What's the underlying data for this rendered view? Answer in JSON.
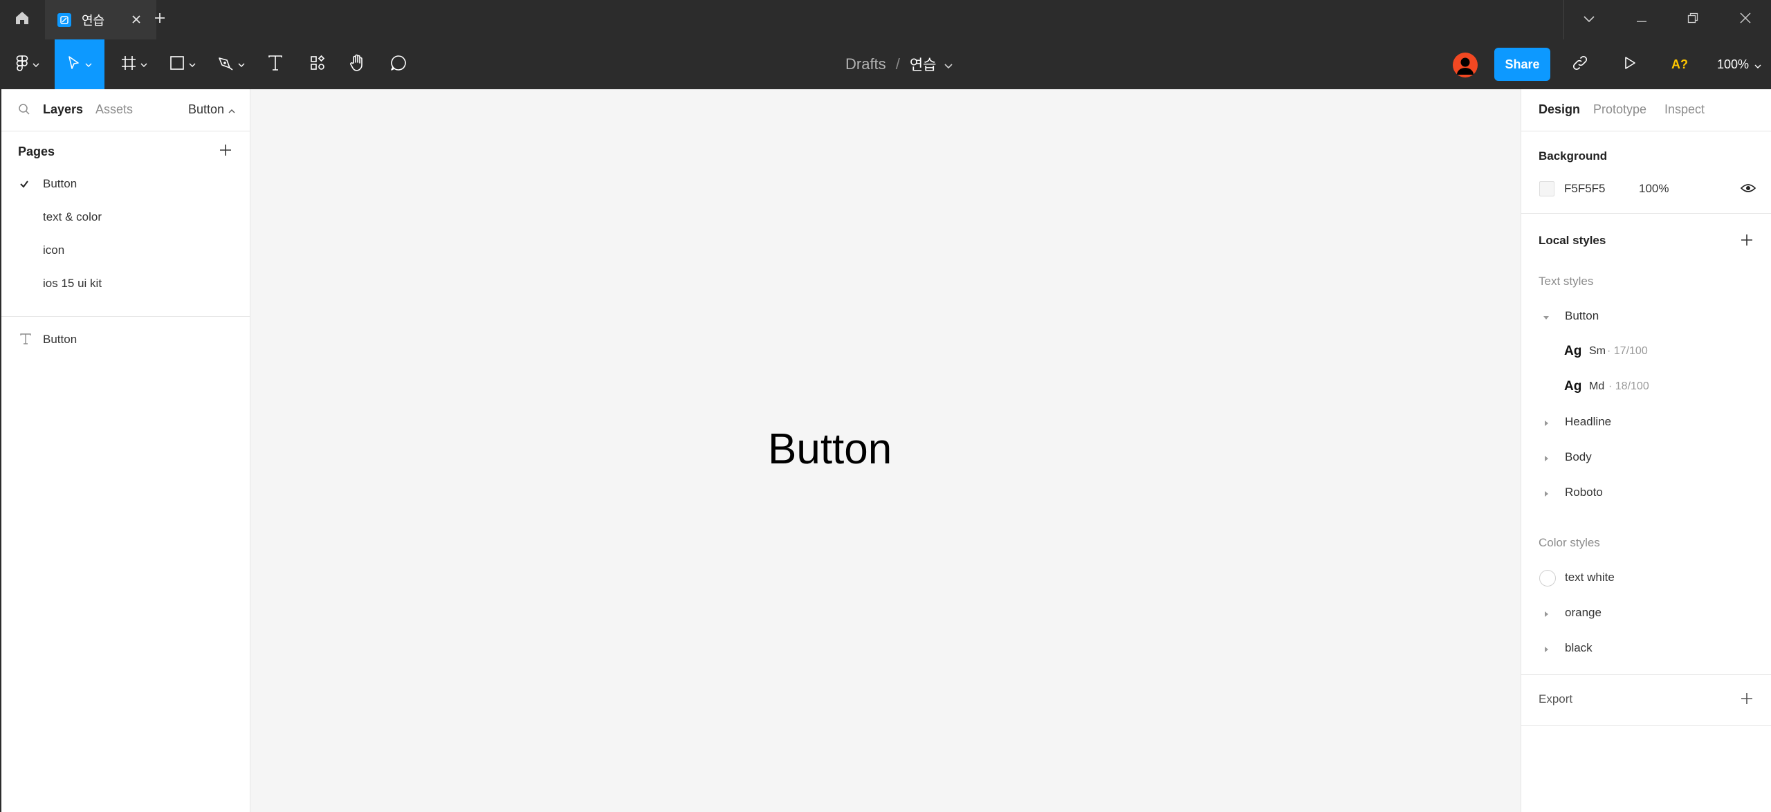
{
  "titlebar": {
    "tab_label": "연습",
    "icons": [
      "home-icon",
      "file-icon",
      "close-icon",
      "plus-icon",
      "chevron-down-icon",
      "minimize-icon",
      "restore-icon",
      "close-window-icon"
    ]
  },
  "toolbar": {
    "breadcrumb_root": "Drafts",
    "breadcrumb_sep": "/",
    "breadcrumb_file": "연습",
    "share_label": "Share",
    "font_warning": "A?",
    "zoom": "100%",
    "accent_color": "#0d99ff",
    "avatar_color": "#f24822"
  },
  "left_panel": {
    "tabs": [
      "Layers",
      "Assets"
    ],
    "current_page": "Button",
    "pages_title": "Pages",
    "pages": [
      {
        "label": "Button",
        "selected": true
      },
      {
        "label": "text & color",
        "selected": false
      },
      {
        "label": "icon",
        "selected": false
      },
      {
        "label": "ios 15 ui kit",
        "selected": false
      }
    ],
    "layers": [
      {
        "label": "Button",
        "type": "text"
      }
    ]
  },
  "canvas": {
    "background": "#F5F5F5",
    "text": "Button"
  },
  "right_panel": {
    "tabs": [
      "Design",
      "Prototype",
      "Inspect"
    ],
    "background_title": "Background",
    "background_hex": "F5F5F5",
    "background_opacity": "100%",
    "local_styles_title": "Local styles",
    "text_styles_title": "Text styles",
    "text_style_group": "Button",
    "text_styles": [
      {
        "sample": "Ag",
        "name": "Sm",
        "meta": "· 17/100"
      },
      {
        "sample": "Ag",
        "name": "Md",
        "meta": "· 18/100"
      }
    ],
    "text_style_groups": [
      "Headline",
      "Body",
      "Roboto"
    ],
    "color_styles_title": "Color styles",
    "color_styles": [
      {
        "label": "text white",
        "kind": "swatch",
        "color": "#ffffff"
      },
      {
        "label": "orange",
        "kind": "group"
      },
      {
        "label": "black",
        "kind": "group"
      }
    ],
    "export_title": "Export"
  }
}
